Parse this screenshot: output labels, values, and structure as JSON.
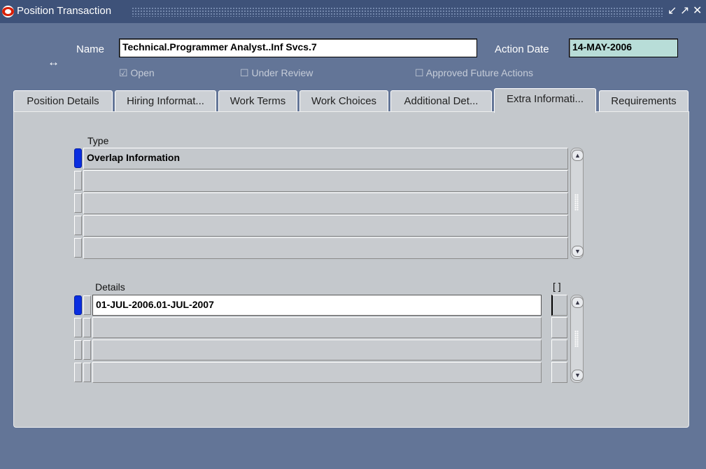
{
  "window": {
    "title": "Position Transaction",
    "controls": [
      "↙",
      "↗",
      "✕"
    ]
  },
  "header": {
    "name_label": "Name",
    "name_value": "Technical.Programmer Analyst..Inf Svcs.7",
    "action_date_label": "Action Date",
    "action_date_value": "14-MAY-2006",
    "resize_glyph": "↔",
    "checks": [
      {
        "label": "Open",
        "checked": true,
        "glyph": "☑"
      },
      {
        "label": "Under Review",
        "checked": false,
        "glyph": "☐"
      },
      {
        "label": "Approved Future Actions",
        "checked": false,
        "glyph": "☐"
      }
    ]
  },
  "tabs": [
    {
      "label": "Position Details"
    },
    {
      "label": "Hiring Informat..."
    },
    {
      "label": "Work Terms"
    },
    {
      "label": "Work Choices"
    },
    {
      "label": "Additional Det..."
    },
    {
      "label": "Extra Informati...",
      "active": true
    },
    {
      "label": "Requirements"
    }
  ],
  "type_block": {
    "header": "Type",
    "rows": [
      "Overlap Information",
      "",
      "",
      "",
      ""
    ]
  },
  "details_block": {
    "header": "Details",
    "flex_header": "[ ]",
    "rows": [
      "01-JUL-2006.01-JUL-2007",
      "",
      "",
      ""
    ]
  },
  "icons": {
    "oracle": "oracle-logo-icon",
    "scroll_up": "▲",
    "scroll_down": "▼"
  }
}
